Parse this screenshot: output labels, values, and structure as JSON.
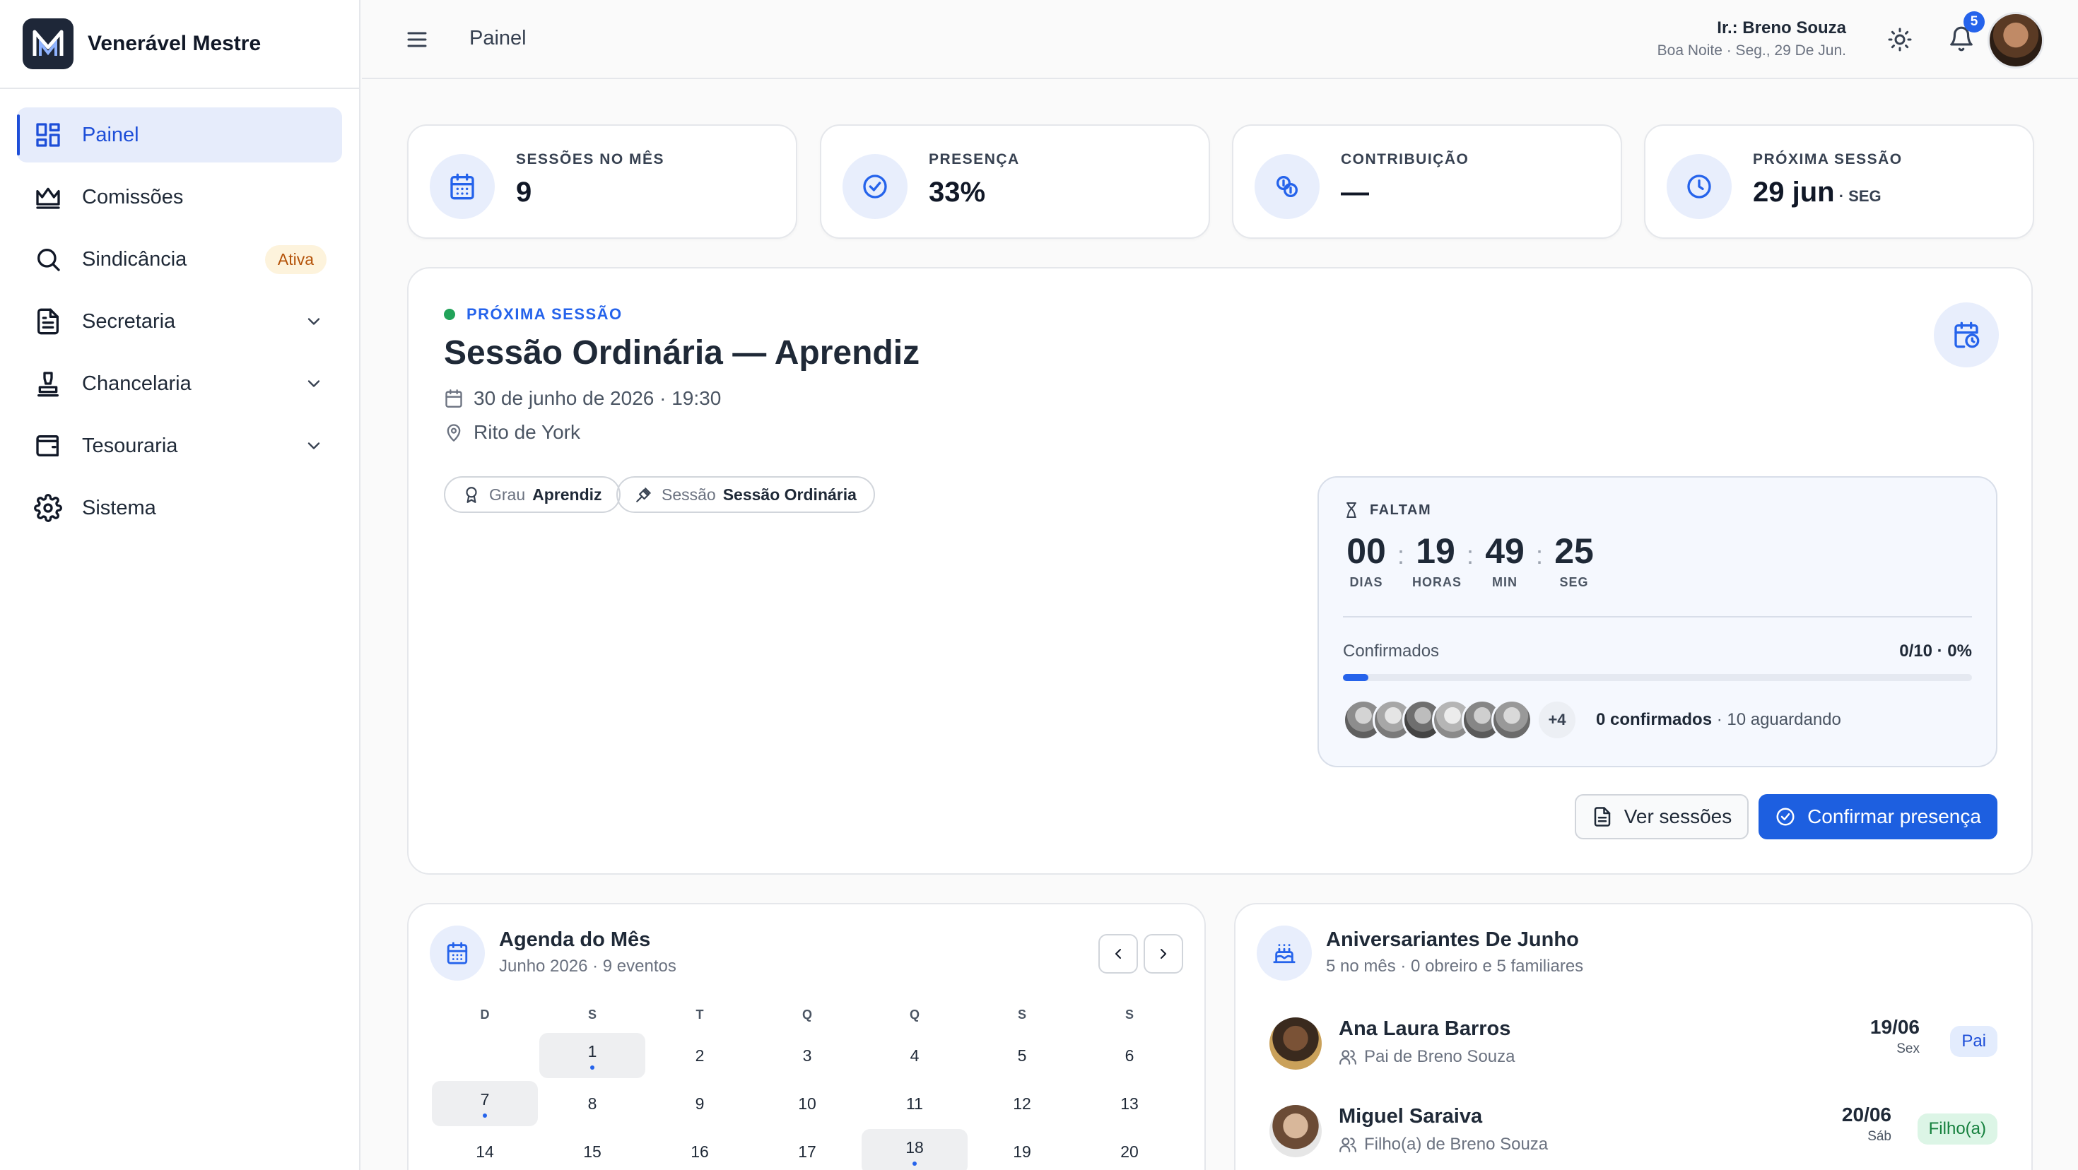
{
  "sidebar": {
    "brand": "Venerável Mestre",
    "items": [
      {
        "label": "Painel",
        "icon": "dashboard-icon"
      },
      {
        "label": "Comissões",
        "icon": "crown-icon"
      },
      {
        "label": "Sindicância",
        "icon": "search-icon",
        "badge": "Ativa"
      },
      {
        "label": "Secretaria",
        "icon": "file-text-icon"
      },
      {
        "label": "Chancelaria",
        "icon": "stamp-icon"
      },
      {
        "label": "Tesouraria",
        "icon": "wallet-icon"
      },
      {
        "label": "Sistema",
        "icon": "gear-icon"
      }
    ]
  },
  "header": {
    "breadcrumb": "Painel",
    "user_name": "Ir.: Breno Souza",
    "greeting": "Boa Noite · Seg., 29 De Jun.",
    "notifications": "5"
  },
  "stats": [
    {
      "label": "SESSÕES NO MÊS",
      "value": "9",
      "suffix": "",
      "icon": "calendar-icon"
    },
    {
      "label": "PRESENÇA",
      "value": "33%",
      "suffix": "",
      "icon": "check-circle-icon"
    },
    {
      "label": "CONTRIBUIÇÃO",
      "value": "—",
      "suffix": "",
      "icon": "coins-icon"
    },
    {
      "label": "PRÓXIMA SESSÃO",
      "value": "29 jun",
      "suffix": " · SEG",
      "icon": "clock-icon"
    }
  ],
  "session": {
    "label": "PRÓXIMA SESSÃO",
    "title": "Sessão Ordinária — Aprendiz",
    "date": "30 de junho de 2026 · 19:30",
    "place": "Rito de York",
    "chips": [
      {
        "key": "Grau",
        "value": "Aprendiz"
      },
      {
        "key": "Sessão",
        "value": "Sessão Ordinária"
      }
    ],
    "countdown": {
      "label": "FALTAM",
      "units": [
        {
          "value": "00",
          "label": "DIAS"
        },
        {
          "value": "19",
          "label": "HORAS"
        },
        {
          "value": "49",
          "label": "MIN"
        },
        {
          "value": "25",
          "label": "SEG"
        }
      ]
    },
    "confirmed_label": "Confirmados",
    "confirmed_value": "0/10 · 0%",
    "confirmed_fraction": 0.04,
    "more_count": "+4",
    "confirmed_count": "0 confirmados",
    "waiting": " · 10 aguardando",
    "btn_sessions": "Ver sessões",
    "btn_confirm": "Confirmar presença"
  },
  "agenda": {
    "title": "Agenda do Mês",
    "subtitle": "Junho 2026 · 9 eventos",
    "weekdays": [
      "D",
      "S",
      "T",
      "Q",
      "Q",
      "S",
      "S"
    ],
    "days": [
      "1",
      "2",
      "3",
      "4",
      "5",
      "6",
      "7",
      "8",
      "9",
      "10",
      "11",
      "12",
      "13",
      "14",
      "15",
      "16",
      "17",
      "18",
      "19",
      "20"
    ],
    "event_days": [
      "1",
      "7",
      "18"
    ]
  },
  "birthdays": {
    "title": "Aniversariantes De Junho",
    "subtitle": "5 no mês · 0 obreiro e 5 familiares",
    "items": [
      {
        "name": "Ana Laura Barros",
        "relation": "Pai de Breno Souza",
        "date": "19/06",
        "weekday": "Sex",
        "tag": "Pai",
        "tag_bg": "#e3ecfd",
        "tag_color": "#1d4ed8"
      },
      {
        "name": "Miguel Saraiva",
        "relation": "Filho(a) de Breno Souza",
        "date": "20/06",
        "weekday": "Sáb",
        "tag": "Filho(a)",
        "tag_bg": "#dcf5e6",
        "tag_color": "#15803d"
      }
    ]
  }
}
